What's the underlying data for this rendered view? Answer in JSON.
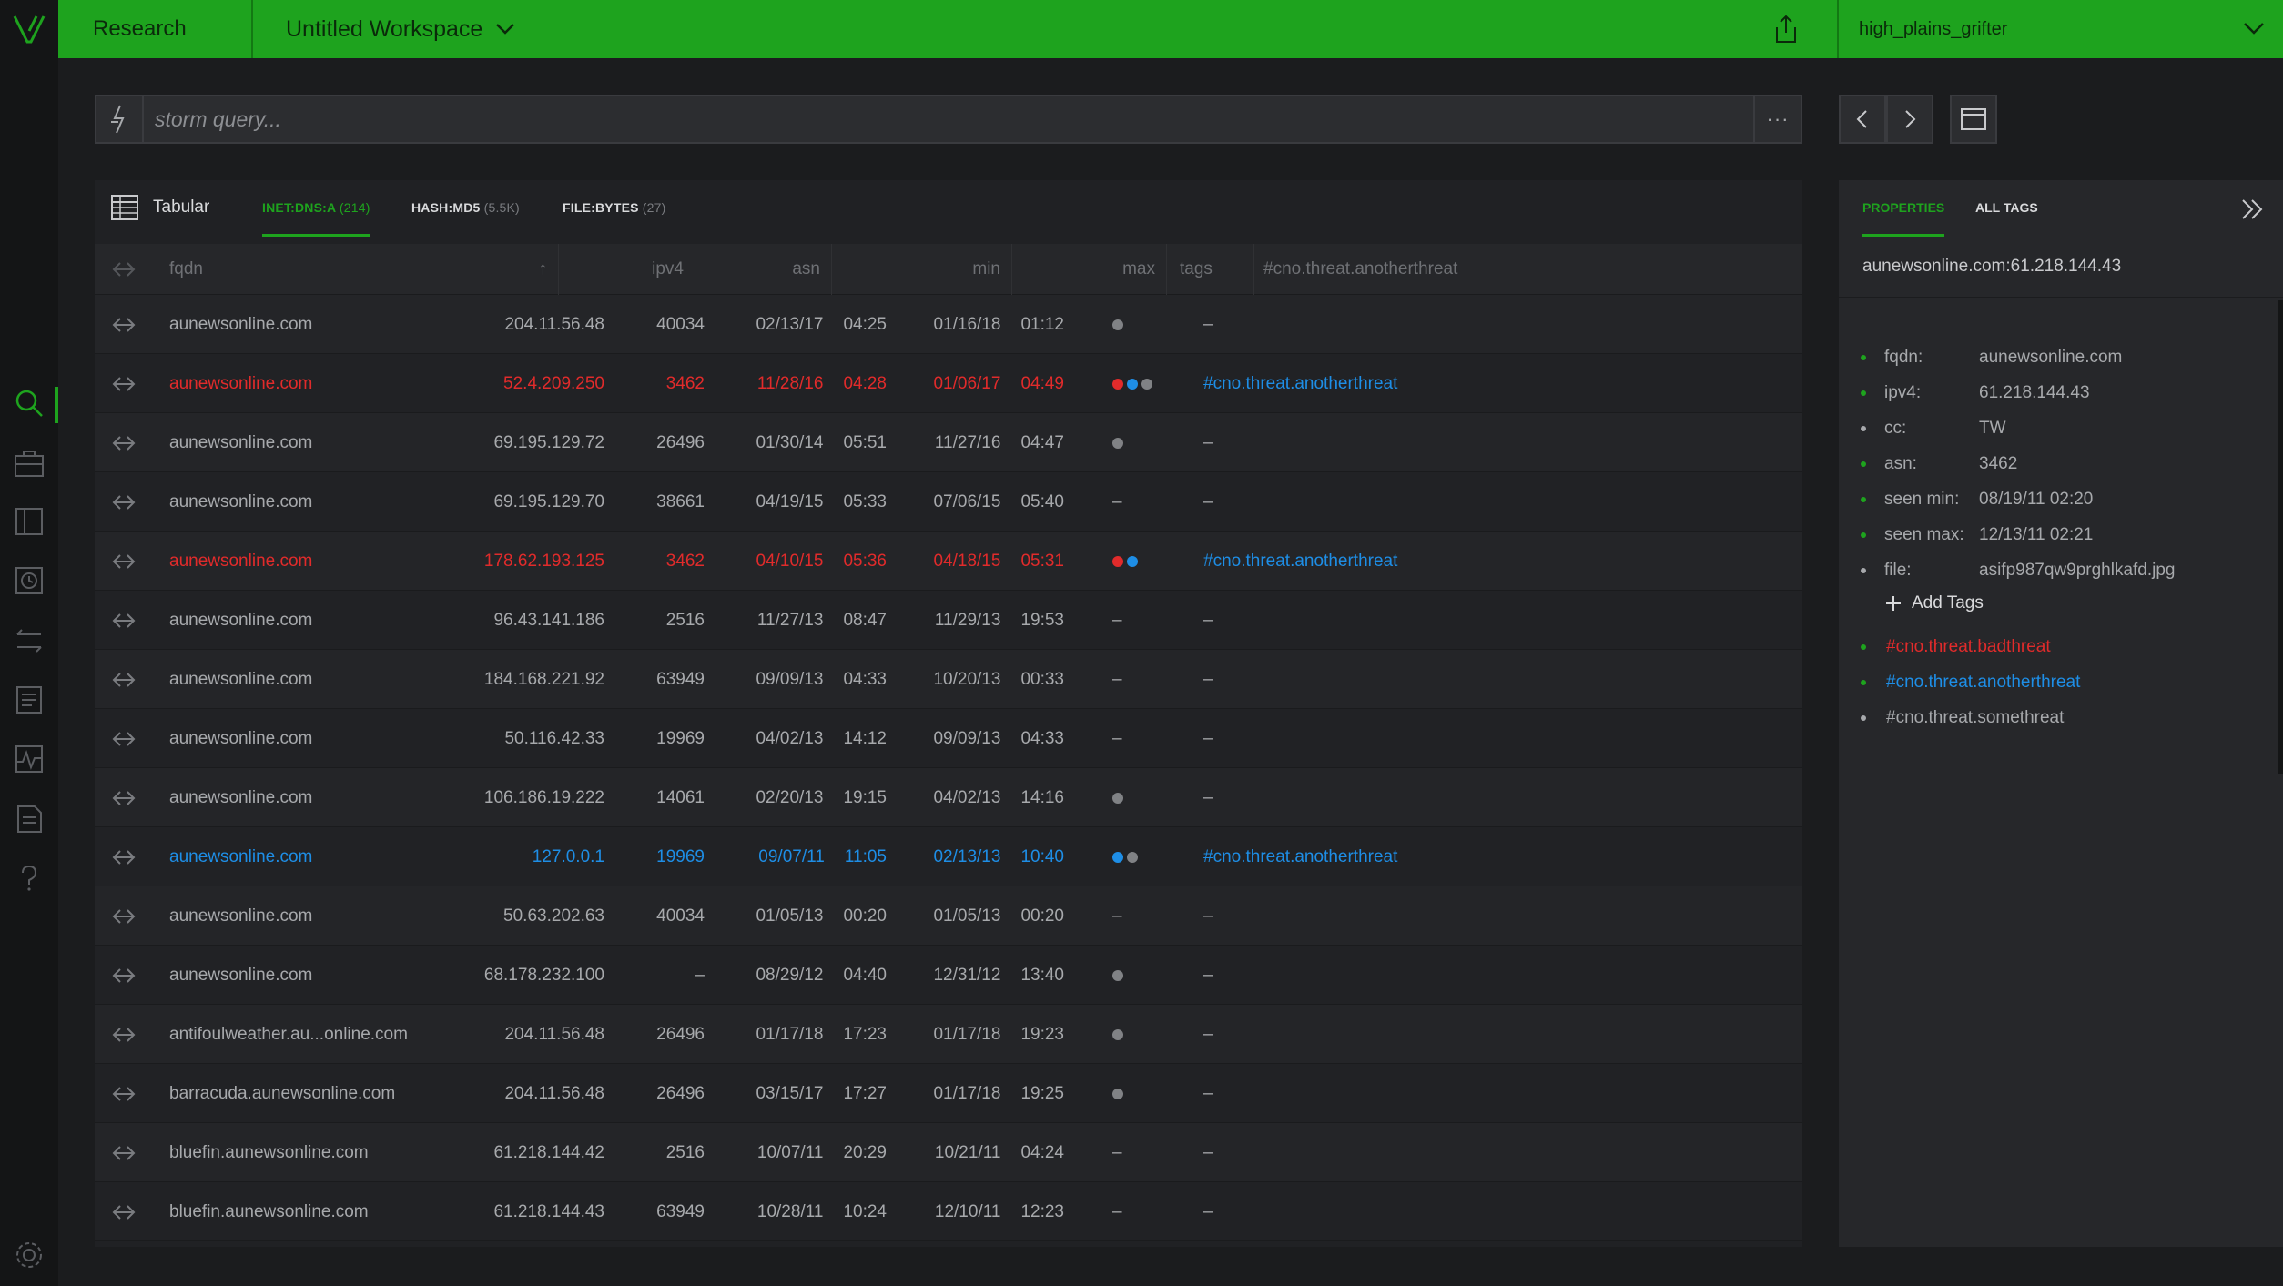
{
  "app": {
    "section": "Research",
    "workspace": "Untitled Workspace",
    "user": "high_plains_grifter"
  },
  "query": {
    "placeholder": "storm query...",
    "more_label": "···"
  },
  "view": {
    "mode_label": "Tabular",
    "tabs": [
      {
        "name": "INET:DNS:A",
        "count": "(214)",
        "active": true
      },
      {
        "name": "HASH:MD5",
        "count": "(5.5K)",
        "active": false
      },
      {
        "name": "FILE:BYTES",
        "count": "(27)",
        "active": false
      }
    ]
  },
  "table": {
    "columns": {
      "fqdn": "fqdn",
      "sort_indicator": "↑",
      "ipv4": "ipv4",
      "asn": "asn",
      "min": "min",
      "max": "max",
      "tags": "tags",
      "threat": "#cno.threat.anotherthreat"
    },
    "rows": [
      {
        "fqdn": "aunewsonline.com",
        "ipv4": "204.11.56.48",
        "asn": "40034",
        "min_d": "02/13/17",
        "min_t": "04:25",
        "max_d": "01/16/18",
        "max_t": "01:12",
        "tags": [
          "gray"
        ],
        "threat": "–",
        "style": ""
      },
      {
        "fqdn": "aunewsonline.com",
        "ipv4": "52.4.209.250",
        "asn": "3462",
        "min_d": "11/28/16",
        "min_t": "04:28",
        "max_d": "01/06/17",
        "max_t": "04:49",
        "tags": [
          "red",
          "blue",
          "gray"
        ],
        "threat": "#cno.threat.anotherthreat",
        "style": "red"
      },
      {
        "fqdn": "aunewsonline.com",
        "ipv4": "69.195.129.72",
        "asn": "26496",
        "min_d": "01/30/14",
        "min_t": "05:51",
        "max_d": "11/27/16",
        "max_t": "04:47",
        "tags": [
          "gray"
        ],
        "threat": "–",
        "style": ""
      },
      {
        "fqdn": "aunewsonline.com",
        "ipv4": "69.195.129.70",
        "asn": "38661",
        "min_d": "04/19/15",
        "min_t": "05:33",
        "max_d": "07/06/15",
        "max_t": "05:40",
        "tags": [],
        "threat": "–",
        "style": ""
      },
      {
        "fqdn": "aunewsonline.com",
        "ipv4": "178.62.193.125",
        "asn": "3462",
        "min_d": "04/10/15",
        "min_t": "05:36",
        "max_d": "04/18/15",
        "max_t": "05:31",
        "tags": [
          "red",
          "blue"
        ],
        "threat": "#cno.threat.anotherthreat",
        "style": "red"
      },
      {
        "fqdn": "aunewsonline.com",
        "ipv4": "96.43.141.186",
        "asn": "2516",
        "min_d": "11/27/13",
        "min_t": "08:47",
        "max_d": "11/29/13",
        "max_t": "19:53",
        "tags": [],
        "threat": "–",
        "style": ""
      },
      {
        "fqdn": "aunewsonline.com",
        "ipv4": "184.168.221.92",
        "asn": "63949",
        "min_d": "09/09/13",
        "min_t": "04:33",
        "max_d": "10/20/13",
        "max_t": "00:33",
        "tags": [],
        "threat": "–",
        "style": ""
      },
      {
        "fqdn": "aunewsonline.com",
        "ipv4": "50.116.42.33",
        "asn": "19969",
        "min_d": "04/02/13",
        "min_t": "14:12",
        "max_d": "09/09/13",
        "max_t": "04:33",
        "tags": [],
        "threat": "–",
        "style": ""
      },
      {
        "fqdn": "aunewsonline.com",
        "ipv4": "106.186.19.222",
        "asn": "14061",
        "min_d": "02/20/13",
        "min_t": "19:15",
        "max_d": "04/02/13",
        "max_t": "14:16",
        "tags": [
          "gray"
        ],
        "threat": "–",
        "style": ""
      },
      {
        "fqdn": "aunewsonline.com",
        "ipv4": "127.0.0.1",
        "asn": "19969",
        "min_d": "09/07/11",
        "min_t": "11:05",
        "max_d": "02/13/13",
        "max_t": "10:40",
        "tags": [
          "blue",
          "gray"
        ],
        "threat": "#cno.threat.anotherthreat",
        "style": "blue"
      },
      {
        "fqdn": "aunewsonline.com",
        "ipv4": "50.63.202.63",
        "asn": "40034",
        "min_d": "01/05/13",
        "min_t": "00:20",
        "max_d": "01/05/13",
        "max_t": "00:20",
        "tags": [],
        "threat": "–",
        "style": ""
      },
      {
        "fqdn": "aunewsonline.com",
        "ipv4": "68.178.232.100",
        "asn": "–",
        "min_d": "08/29/12",
        "min_t": "04:40",
        "max_d": "12/31/12",
        "max_t": "13:40",
        "tags": [
          "gray"
        ],
        "threat": "–",
        "style": ""
      },
      {
        "fqdn": "antifoulweather.au...online.com",
        "ipv4": "204.11.56.48",
        "asn": "26496",
        "min_d": "01/17/18",
        "min_t": "17:23",
        "max_d": "01/17/18",
        "max_t": "19:23",
        "tags": [
          "gray"
        ],
        "threat": "–",
        "style": ""
      },
      {
        "fqdn": "barracuda.aunewsonline.com",
        "ipv4": "204.11.56.48",
        "asn": "26496",
        "min_d": "03/15/17",
        "min_t": "17:27",
        "max_d": "01/17/18",
        "max_t": "19:25",
        "tags": [
          "gray"
        ],
        "threat": "–",
        "style": ""
      },
      {
        "fqdn": "bluefin.aunewsonline.com",
        "ipv4": "61.218.144.42",
        "asn": "2516",
        "min_d": "10/07/11",
        "min_t": "20:29",
        "max_d": "10/21/11",
        "max_t": "04:24",
        "tags": [],
        "threat": "–",
        "style": ""
      },
      {
        "fqdn": "bluefin.aunewsonline.com",
        "ipv4": "61.218.144.43",
        "asn": "63949",
        "min_d": "10/28/11",
        "min_t": "10:24",
        "max_d": "12/10/11",
        "max_t": "12:23",
        "tags": [],
        "threat": "–",
        "style": ""
      }
    ]
  },
  "properties": {
    "tabs": {
      "properties": "PROPERTIES",
      "all_tags": "ALL TAGS"
    },
    "node": "aunewsonline.com:61.218.144.43",
    "items": [
      {
        "key": "fqdn:",
        "value": "aunewsonline.com",
        "bullet": "green"
      },
      {
        "key": "ipv4:",
        "value": "61.218.144.43",
        "bullet": "green"
      },
      {
        "key": "cc:",
        "value": "TW",
        "bullet": "gray"
      },
      {
        "key": "asn:",
        "value": "3462",
        "bullet": "green"
      },
      {
        "key": "seen min:",
        "value": "08/19/11  02:20",
        "bullet": "green"
      },
      {
        "key": "seen max:",
        "value": "12/13/11  02:21",
        "bullet": "green"
      },
      {
        "key": "file:",
        "value": "asifp987qw9prghlkafd.jpg",
        "bullet": "gray"
      }
    ],
    "add_tags_label": "Add Tags",
    "tags": [
      {
        "name": "#cno.threat.badthreat",
        "color": "#e12b2b"
      },
      {
        "name": "#cno.threat.anotherthreat",
        "color": "#1e8ee6"
      },
      {
        "name": "#cno.threat.somethreat",
        "color": "#a7a9ac"
      }
    ]
  },
  "colors": {
    "accent": "#1ea31e",
    "red": "#e12b2b",
    "blue": "#1e8ee6",
    "gray": "#808285"
  },
  "icons": {
    "rail": [
      "search-icon",
      "briefcase-icon",
      "book-icon",
      "history-icon",
      "transfer-icon",
      "notes-icon",
      "activity-icon",
      "document-icon",
      "help-icon",
      "settings-icon"
    ]
  }
}
